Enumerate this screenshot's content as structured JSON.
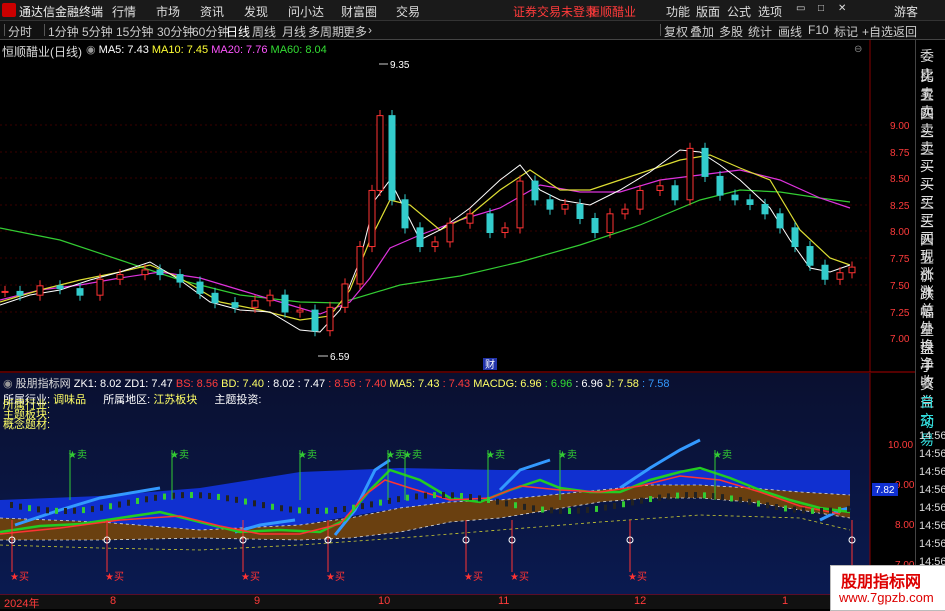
{
  "app": {
    "name": "通达信金融终端",
    "menus": [
      "行情",
      "市场",
      "资讯",
      "发现",
      "问小达",
      "财富圈",
      "交易"
    ],
    "notice": "证券交易未登录",
    "stock_name": "恒顺醋业",
    "right_menus": [
      "功能",
      "版面",
      "公式",
      "选项"
    ],
    "user": "游客"
  },
  "periods": {
    "tabs": [
      "分时",
      "1分钟",
      "5分钟",
      "15分钟",
      "30分钟",
      "60分钟",
      "日线",
      "周线",
      "月线",
      "多周期",
      "更多"
    ],
    "active": "日线",
    "right_tabs": [
      "复权",
      "叠加",
      "多股",
      "统计",
      "画线",
      "F10",
      "标记",
      "+自选",
      "返回"
    ]
  },
  "main_chart": {
    "title": "恒顺醋业(日线)",
    "ma_labels": [
      {
        "text": "MA5: 7.43",
        "color": "#ffffff"
      },
      {
        "text": "MA10: 7.45",
        "color": "#ffff00"
      },
      {
        "text": "MA20: 7.76",
        "color": "#ff55ff"
      },
      {
        "text": "MA60: 8.04",
        "color": "#33dd33"
      }
    ],
    "y_ticks": [
      "9.00",
      "8.75",
      "8.50",
      "8.25",
      "8.00",
      "7.75",
      "7.50",
      "7.25",
      "7.00"
    ],
    "high_label": "9.35",
    "low_label": "6.59",
    "badge": "财"
  },
  "sub_chart": {
    "title": "股朋指标网",
    "values": [
      {
        "text": "ZK1: 8.02",
        "color": "#ffffff"
      },
      {
        "text": "ZD1: 7.47",
        "color": "#ffffff"
      },
      {
        "text": "BS: 8.56",
        "color": "#ff3b3b"
      },
      {
        "text": "BD: 7.40",
        "color": "#ffff66"
      },
      {
        "text": ": 8.02",
        "color": "#ffffff"
      },
      {
        "text": ": 7.47",
        "color": "#ffffff"
      },
      {
        "text": ": 8.56",
        "color": "#ff3b3b"
      },
      {
        "text": ": 7.40",
        "color": "#ff3b3b"
      },
      {
        "text": "MA5: 7.43",
        "color": "#ffff66"
      },
      {
        "text": ": 7.43",
        "color": "#ff3b3b"
      },
      {
        "text": "MACDG: 6.96",
        "color": "#ffff66"
      },
      {
        "text": ": 6.96",
        "color": "#33dd33"
      },
      {
        "text": ": 6.96",
        "color": "#ffffff"
      },
      {
        "text": "J: 7.58",
        "color": "#ffff66"
      },
      {
        "text": ": 7.58",
        "color": "#3399ff"
      }
    ],
    "industry_label": "所属行业:",
    "industry_value": "调味品",
    "region_label": "所属地区:",
    "region_value": "江苏板块",
    "theme_label": "主题投资:",
    "extra_lines": [
      "所属行业:",
      "主题板块:",
      "概念题材:"
    ],
    "y_ticks": [
      "10.00",
      "9.00",
      "8.00",
      "7.00"
    ],
    "current_price": "7.82",
    "buy_label": "买",
    "sell_label": "卖"
  },
  "x_axis": [
    "2024年",
    "8",
    "9",
    "10",
    "11",
    "12",
    "1"
  ],
  "right_panel": {
    "items": [
      "委比",
      "卖五",
      "卖四",
      "卖三",
      "卖二",
      "卖一",
      "买一",
      "买二",
      "买三",
      "买四",
      "买五",
      "现价",
      "涨跌",
      "涨幅",
      "总量",
      "外盘",
      "换手",
      "净资",
      "收益"
    ],
    "auto_label": "自动",
    "trade_label": "交易",
    "times": [
      "14:56",
      "14:56",
      "14:56",
      "14:56",
      "14:56",
      "14:56",
      "14:56",
      "14:56"
    ]
  },
  "watermark": {
    "line1": "股朋指标网",
    "line2": "www.7gpzb.com"
  }
}
